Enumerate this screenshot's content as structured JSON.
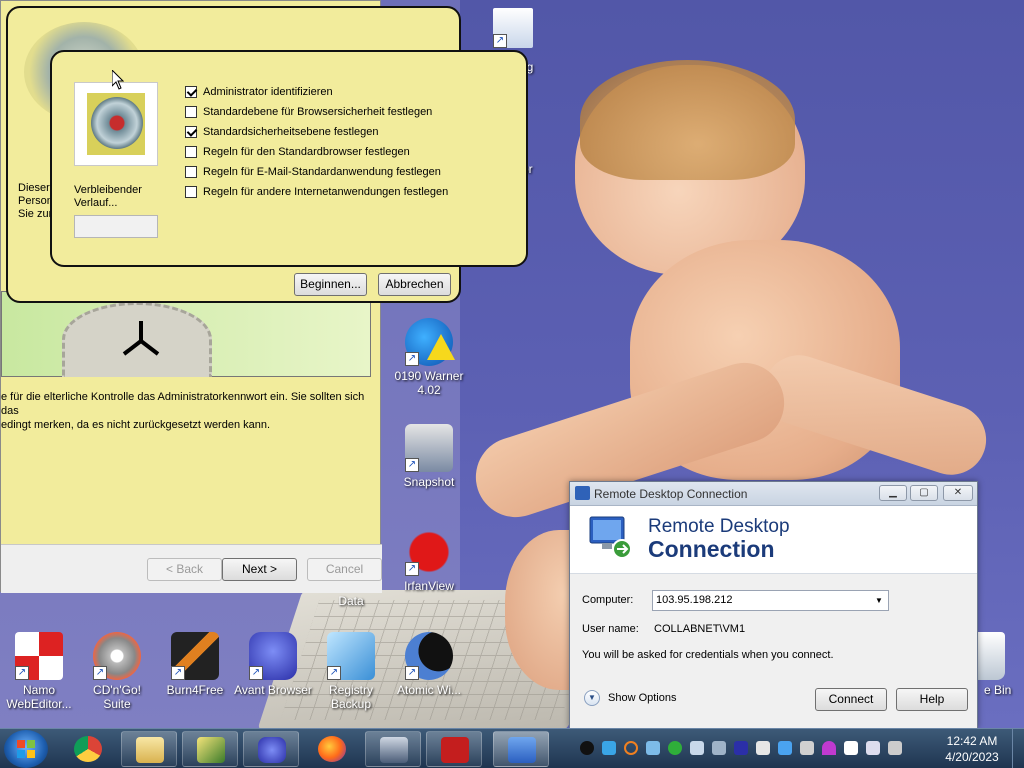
{
  "wizard": {
    "text_line1": "e für die elterliche Kontrolle das Administratorkennwort ein. Sie sollten sich das",
    "text_line2": "edingt merken, da es nicht zurückgesetzt werden kann.",
    "back_label": "< Back",
    "next_label": "Next >",
    "cancel_label": "Cancel"
  },
  "outer_dialog": {
    "left_text_line1": "Dieser",
    "left_text_line2": "Person",
    "left_text_line3": "Sie zun",
    "begin_label": "Beginnen...",
    "abort_label": "Abbrechen"
  },
  "inner_dialog": {
    "remaining_label": "Verbleibender Verlauf...",
    "items": [
      {
        "label": "Administrator identifizieren",
        "checked": true
      },
      {
        "label": "Standardebene für Browsersicherheit festlegen",
        "checked": false
      },
      {
        "label": "Standardsicherheitsebene festlegen",
        "checked": true
      },
      {
        "label": "Regeln für den Standardbrowser festlegen",
        "checked": false
      },
      {
        "label": "Regeln für E-Mail-Standardanwendung festlegen",
        "checked": false
      },
      {
        "label": "Regeln für andere Internetanwendungen festlegen",
        "checked": false
      }
    ]
  },
  "desktop_icons": {
    "partial_top1": "ng",
    "partial_top2": "or",
    "warner": "0190 Warner 4.02",
    "snapshot": "Snapshot",
    "irfanview": "IrfanView",
    "data": "Data",
    "namo": "Namo WebEditor...",
    "cdngo": "CD'n'Go! Suite",
    "burn4free": "Burn4Free",
    "avant": "Avant Browser",
    "registry": "Registry Backup",
    "atomic": "Atomic Wi...",
    "recycle": "e Bin"
  },
  "rdc": {
    "title": "Remote Desktop Connection",
    "header_line1": "Remote Desktop",
    "header_line2": "Connection",
    "computer_label": "Computer:",
    "computer_value": "103.95.198.212",
    "username_label": "User name:",
    "username_value": "COLLABNET\\VM1",
    "note": "You will be asked for credentials when you connect.",
    "show_options": "Show Options",
    "connect_label": "Connect",
    "help_label": "Help"
  },
  "taskbar": {
    "time": "12:42 AM",
    "date": "4/20/2023"
  },
  "colors": {
    "dialog_bg": "#f2ec9c",
    "taskbar": "#1f3550",
    "accent": "#1b3b7a"
  }
}
